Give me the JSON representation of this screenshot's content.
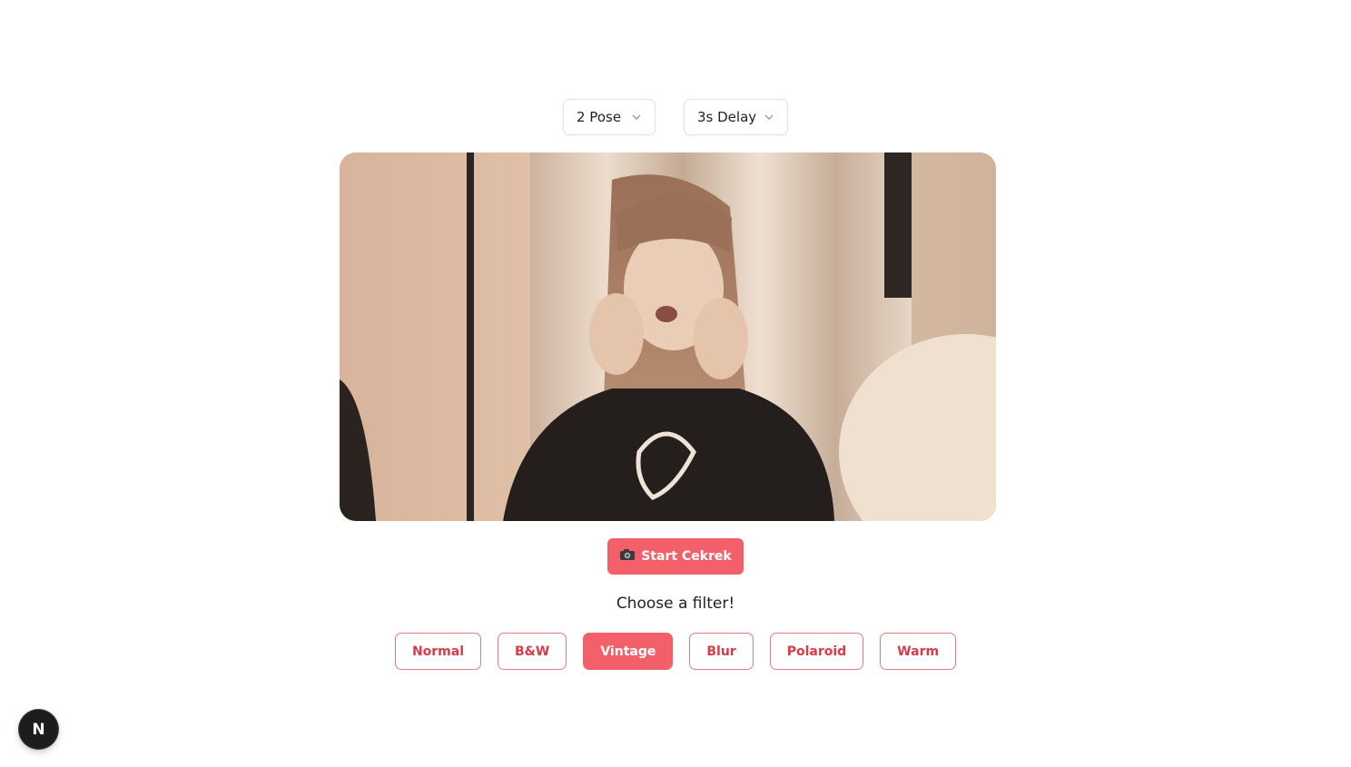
{
  "controls": {
    "pose": {
      "value": "2 Pose"
    },
    "delay": {
      "value": "3s Delay"
    }
  },
  "camera": {
    "active_filter": "Vintage"
  },
  "start_button": {
    "icon": "camera-icon",
    "label": "Start Cekrek"
  },
  "filter_section": {
    "prompt": "Choose a filter!",
    "options": [
      "Normal",
      "B&W",
      "Vintage",
      "Blur",
      "Polaroid",
      "Warm"
    ],
    "selected_index": 2
  },
  "dev_badge": {
    "letter": "N",
    "icon": "nextjs-logo-icon"
  },
  "colors": {
    "accent": "#f4606a",
    "accent_text": "#d93a48",
    "accent_border": "#e97a82"
  }
}
